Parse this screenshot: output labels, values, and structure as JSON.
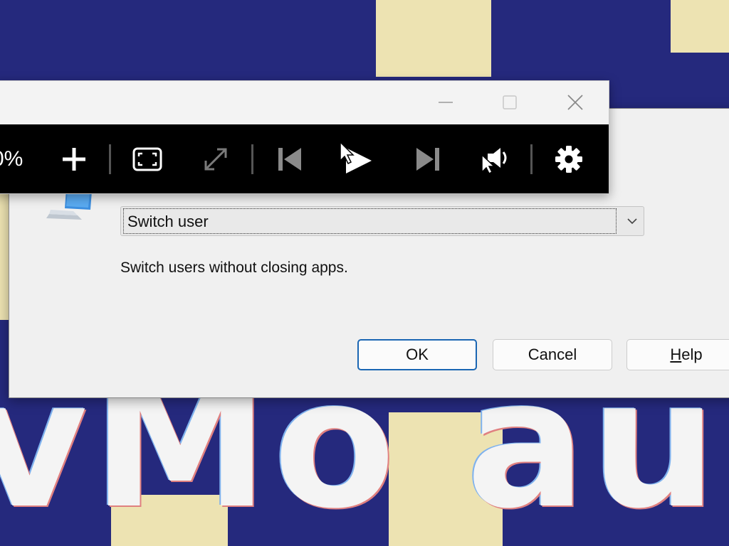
{
  "dialog": {
    "select": {
      "value": "Switch user"
    },
    "description": "Switch users without closing apps.",
    "buttons": {
      "ok": "OK",
      "cancel": "Cancel",
      "help_mnemonic": "H",
      "help_rest": "elp"
    }
  },
  "media_window": {
    "toolbar": {
      "zoom_text": "0%",
      "icons": [
        "plus-icon",
        "fit-screen-icon",
        "expand-icon",
        "skip-previous-icon",
        "play-icon",
        "skip-next-icon",
        "volume-icon",
        "gear-icon"
      ]
    },
    "caption_buttons": [
      "minimize-icon",
      "maximize-icon",
      "close-icon"
    ]
  },
  "colors": {
    "wallpaper_blue": "#25297d",
    "wallpaper_tile": "#ede3b2",
    "toolbar_bg": "#000000",
    "primary_border": "#1a66b3"
  }
}
